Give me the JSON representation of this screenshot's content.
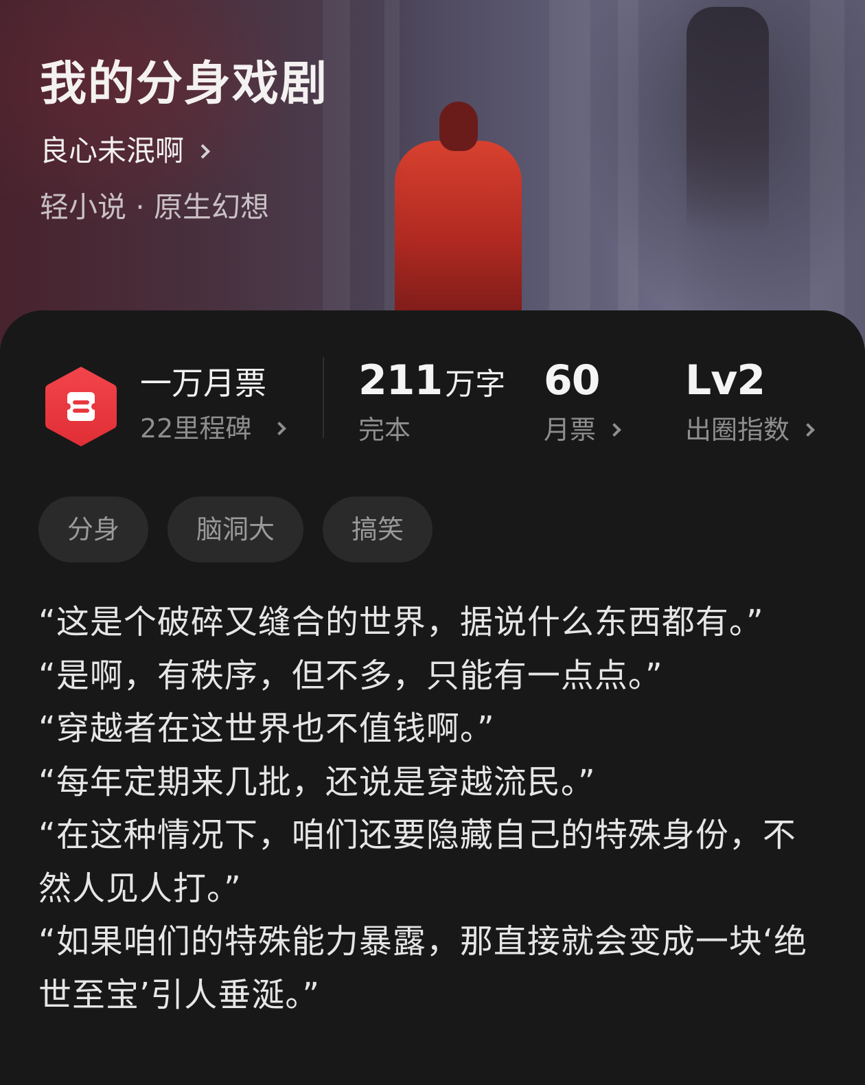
{
  "book": {
    "title": "我的分身戏剧",
    "author": "良心未泯啊",
    "genre": "轻小说 · 原生幻想"
  },
  "stats": {
    "milestone_title": "一万月票",
    "milestone_sub": "22里程碑",
    "word_count": "211",
    "word_unit": "万字",
    "status": "完本",
    "monthly_votes": "60",
    "monthly_votes_label": "月票",
    "circle_index": "Lv2",
    "circle_index_label": "出圈指数"
  },
  "tags": [
    "分身",
    "脑洞大",
    "搞笑"
  ],
  "intro": [
    "“这是个破碎又缝合的世界，据说什么东西都有。”",
    "“是啊，有秩序，但不多，只能有一点点。”",
    "“穿越者在这世界也不值钱啊。”",
    "“每年定期来几批，还说是穿越流民。”",
    "“在这种情况下，咱们还要隐藏自己的特殊身份，不然人见人打。”",
    "“如果咱们的特殊能力暴露，那直接就会变成一块‘绝世至宝’引人垂涎。”"
  ],
  "icons": {
    "milestone_badge": "ticket-hexagon-icon",
    "chevron": "chevron-right-icon"
  },
  "colors": {
    "badge_red": "#e8383f",
    "background": "#181818",
    "tag_bg": "#2a2a2a",
    "muted_text": "#8e8e8e"
  }
}
